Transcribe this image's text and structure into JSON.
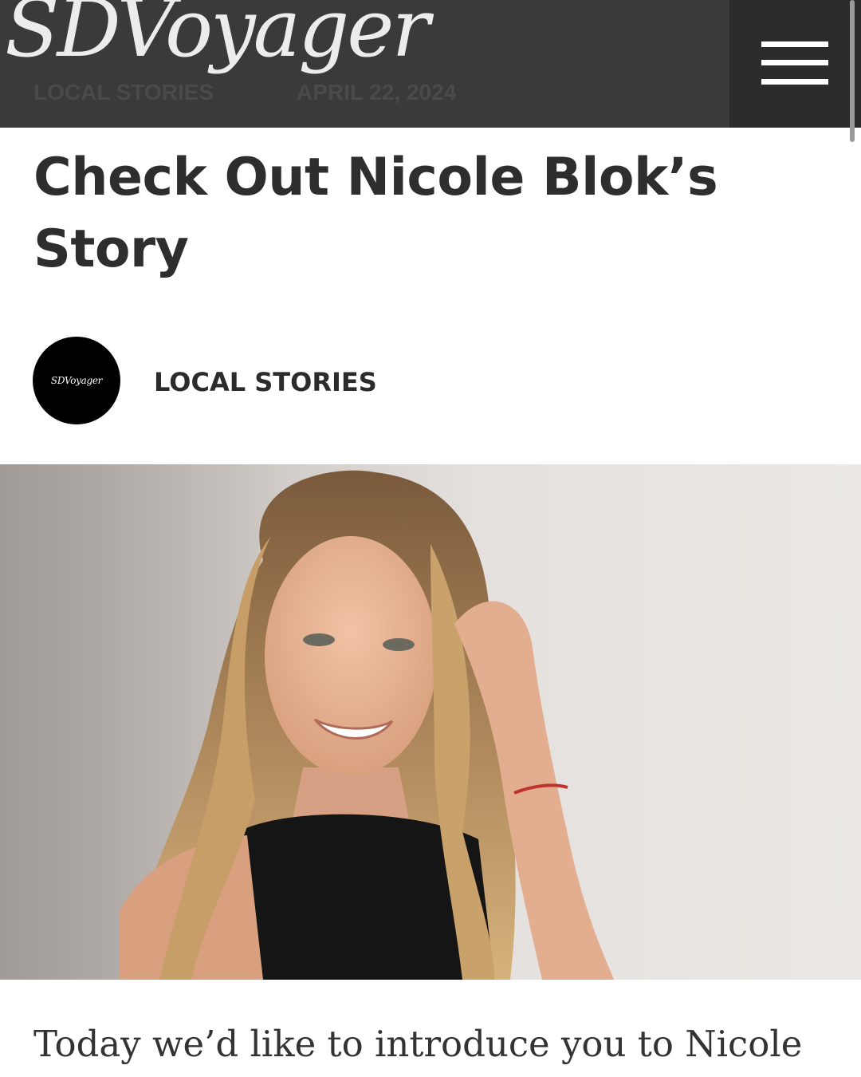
{
  "header": {
    "logo_text": "SDVoyager",
    "ghost_category": "LOCAL STORIES",
    "ghost_date": "APRIL 22, 2024",
    "menu_icon": "hamburger-menu-icon"
  },
  "article": {
    "title": "Check Out Nicole Blok’s Story",
    "author_avatar_text": "SDVoyager",
    "category": "LOCAL STORIES",
    "intro": "Today we’d like to introduce you to Nicole"
  },
  "colors": {
    "header_bg": "#3a3a3a",
    "menu_bg": "#2c2c2c",
    "title_text": "#2e2e2e",
    "avatar_bg": "#000000",
    "body_text": "#333333"
  }
}
